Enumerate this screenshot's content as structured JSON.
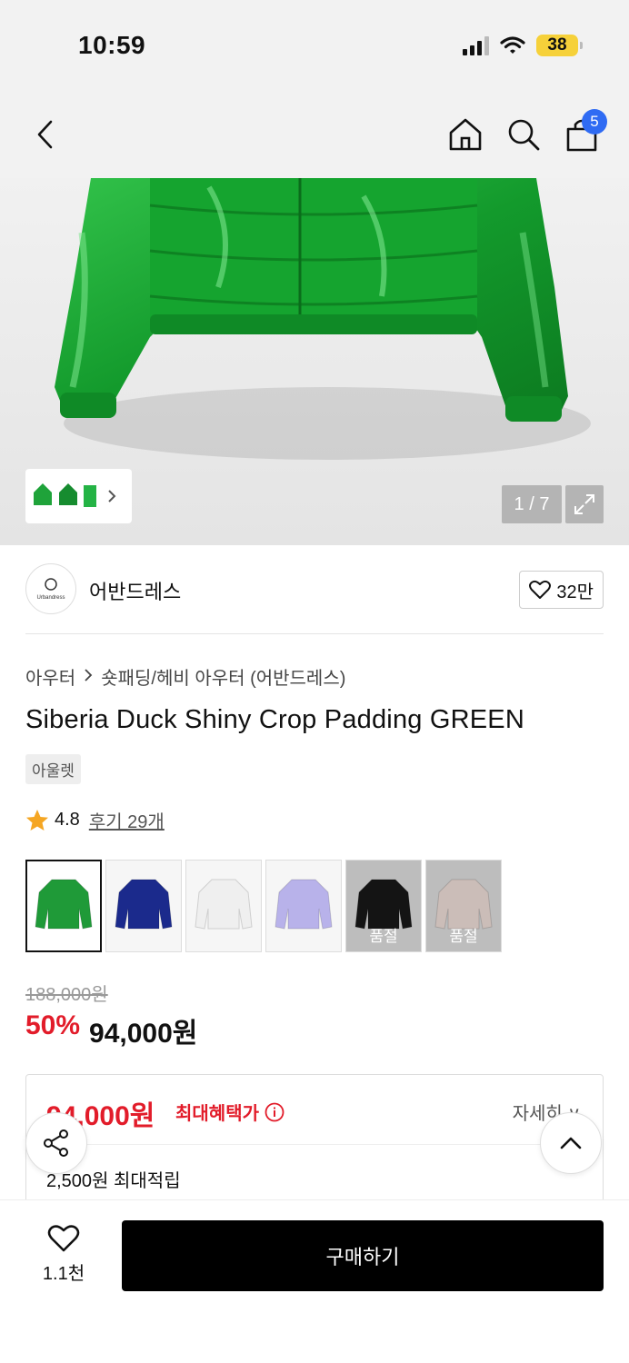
{
  "status_bar": {
    "time": "10:59",
    "battery": "38"
  },
  "nav": {
    "cart_count": "5"
  },
  "gallery": {
    "pager": "1 / 7"
  },
  "brand": {
    "name": "어반드레스",
    "logo_text": "Urbandress",
    "likes": "32만"
  },
  "breadcrumb": {
    "category": "아우터",
    "subcategory": "숏패딩/헤비 아우터 (어반드레스)"
  },
  "product": {
    "title": "Siberia Duck Shiny Crop Padding GREEN",
    "tag": "아울렛",
    "rating": "4.8",
    "reviews": "후기 29개"
  },
  "swatches": [
    {
      "color": "#1f9a38",
      "soldout": false,
      "selected": true,
      "label": ""
    },
    {
      "color": "#1b2a8c",
      "soldout": false,
      "selected": false,
      "label": ""
    },
    {
      "color": "#efefef",
      "soldout": false,
      "selected": false,
      "label": ""
    },
    {
      "color": "#b8b2ea",
      "soldout": false,
      "selected": false,
      "label": ""
    },
    {
      "color": "#141414",
      "soldout": true,
      "selected": false,
      "label": "품절"
    },
    {
      "color": "#cbbdb8",
      "soldout": true,
      "selected": false,
      "label": "품절"
    }
  ],
  "price": {
    "original": "188,000원",
    "discount": "50%",
    "sale": "94,000원"
  },
  "benefit": {
    "price": "94,000원",
    "label": "최대혜택가",
    "detail": "자세히 ∨",
    "points": "2,500원 최대적립"
  },
  "bottom": {
    "wish_count": "1.1천",
    "buy_label": "구매하기"
  },
  "colors": {
    "accent_red": "#e21c2a",
    "badge_blue": "#2f6bf3",
    "battery_yellow": "#f6d13a"
  }
}
